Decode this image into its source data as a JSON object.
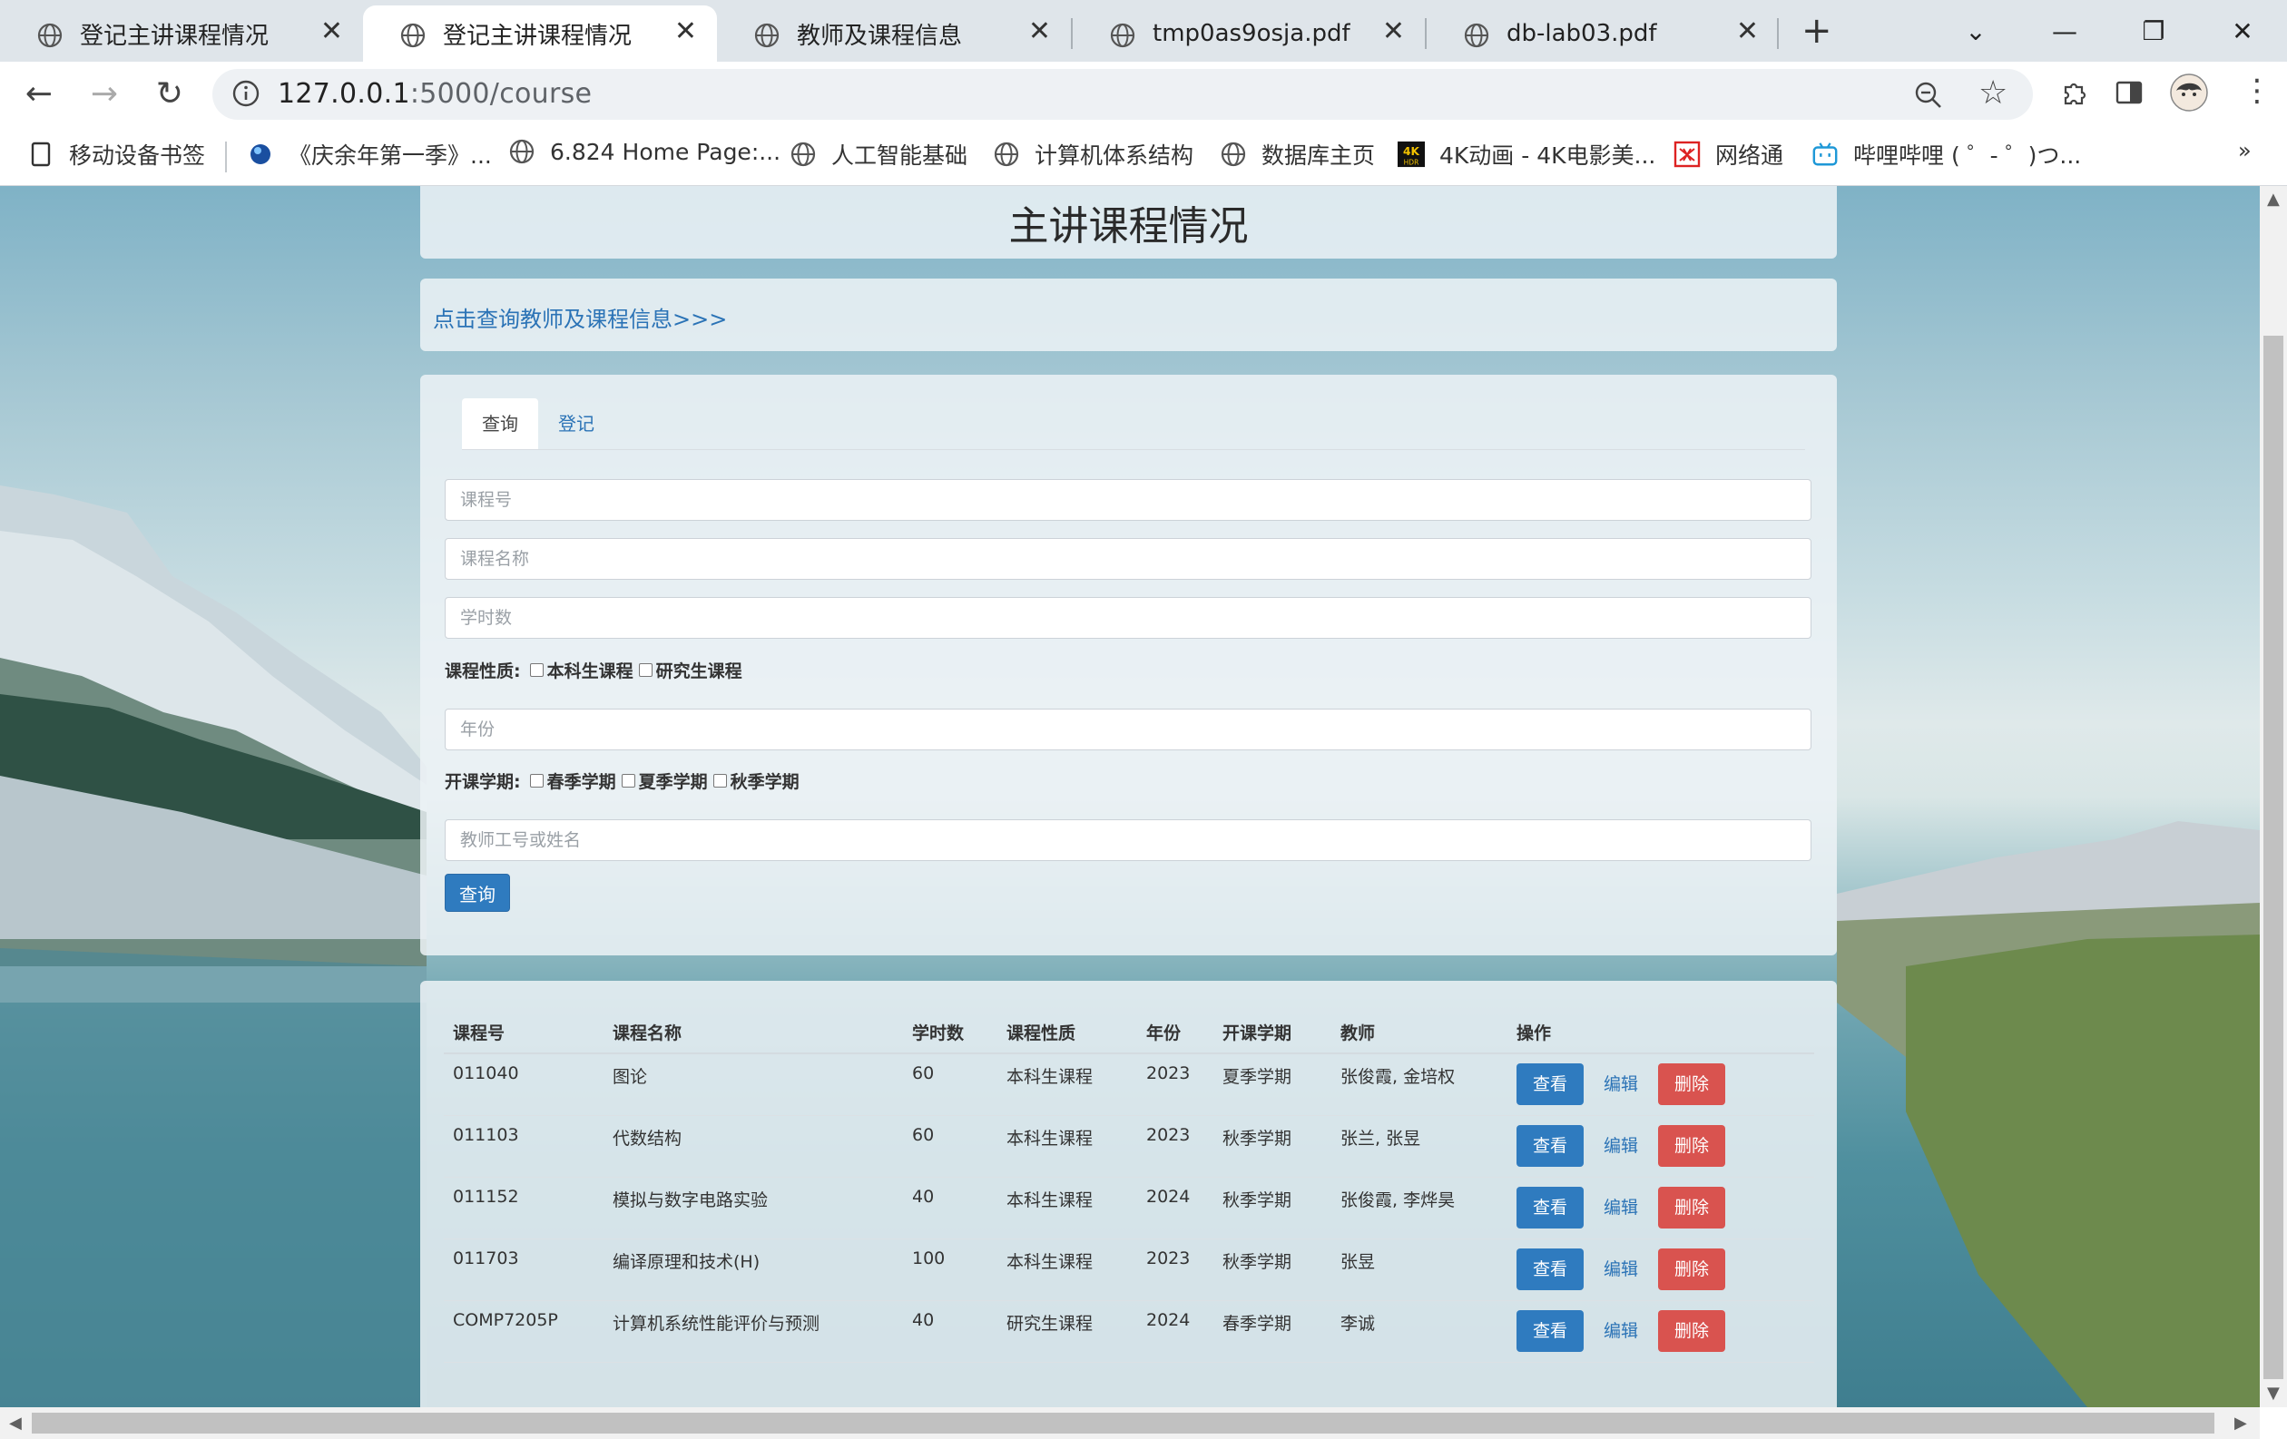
{
  "browser": {
    "tabs": [
      {
        "label": "登记主讲课程情况",
        "active": false
      },
      {
        "label": "登记主讲课程情况",
        "active": true
      },
      {
        "label": "教师及课程信息",
        "active": false
      },
      {
        "label": "tmp0as9osja.pdf",
        "active": false
      },
      {
        "label": "db-lab03.pdf",
        "active": false
      }
    ],
    "url_host": "127.0.0.1",
    "url_path": ":5000/course",
    "bookmarks": [
      "移动设备书签",
      "《庆余年第一季》...",
      "6.824 Home Page:...",
      "人工智能基础",
      "计算机体系结构",
      "数据库主页",
      "4K动画 - 4K电影美...",
      "网络通",
      "哔哩哔哩 ( ゜- ゜)つ..."
    ]
  },
  "page": {
    "title": "主讲课程情况",
    "link_text": "点击查询教师及课程信息>>>",
    "tabs": {
      "query": "查询",
      "register": "登记"
    },
    "form": {
      "course_id_placeholder": "课程号",
      "course_name_placeholder": "课程名称",
      "hours_placeholder": "学时数",
      "nature_label": "课程性质:",
      "nature_options": [
        "本科生课程",
        "研究生课程"
      ],
      "year_placeholder": "年份",
      "semester_label": "开课学期:",
      "semester_options": [
        "春季学期",
        "夏季学期",
        "秋季学期"
      ],
      "teacher_placeholder": "教师工号或姓名",
      "submit_label": "查询"
    },
    "table": {
      "headers": [
        "课程号",
        "课程名称",
        "学时数",
        "课程性质",
        "年份",
        "开课学期",
        "教师",
        "操作"
      ],
      "rows": [
        [
          "011040",
          "图论",
          "60",
          "本科生课程",
          "2023",
          "夏季学期",
          "张俊霞, 金培权"
        ],
        [
          "011103",
          "代数结构",
          "60",
          "本科生课程",
          "2023",
          "秋季学期",
          "张兰, 张昱"
        ],
        [
          "011152",
          "模拟与数字电路实验",
          "40",
          "本科生课程",
          "2024",
          "秋季学期",
          "张俊霞, 李烨昊"
        ],
        [
          "011703",
          "编译原理和技术(H)",
          "100",
          "本科生课程",
          "2023",
          "秋季学期",
          "张昱"
        ],
        [
          "COMP7205P",
          "计算机系统性能评价与预测",
          "40",
          "研究生课程",
          "2024",
          "春季学期",
          "李诚"
        ]
      ],
      "actions": {
        "view": "查看",
        "edit": "编辑",
        "delete": "删除"
      }
    }
  }
}
